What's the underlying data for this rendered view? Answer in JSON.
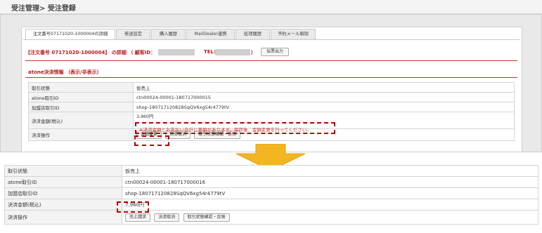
{
  "header": {
    "title": "受注管理> 受注登録"
  },
  "tabs": [
    {
      "label": "注文番号07171020-1000004の詳細",
      "active": true
    },
    {
      "label": "発送設定"
    },
    {
      "label": "購入履歴"
    },
    {
      "label": "MailDealer連携"
    },
    {
      "label": "処理履歴"
    },
    {
      "label": "予約メール解除"
    }
  ],
  "order_detail": {
    "heading": "【注文番号 07171020-1000004】 の詳細 （ 顧客ID：",
    "tel_label": "TEL:",
    "close_paren": "）",
    "print_button": "伝票出力"
  },
  "atone_section": {
    "title": "atone決済情報",
    "toggle": "（表示/非表示）"
  },
  "top_table": {
    "rows": [
      {
        "label": "取引状態",
        "value": "仮売上"
      },
      {
        "label": "atone取引ID",
        "value": "ctn00024-00001-180717000015"
      },
      {
        "label": "加盟店取引ID",
        "value": "shop-180717120828SqQV6xg54r4779tV"
      },
      {
        "label": "決済金額(税込)",
        "value": "3,960円"
      }
    ],
    "warning": "※決済金額とお支払い合計に差額があります。保存後、金額変更を行ってください。",
    "operation_label": "決済操作",
    "buttons": [
      "金額変更",
      "決済取消",
      "取引状態確認・反映"
    ]
  },
  "bottom_table": {
    "rows": [
      {
        "label": "取引状態",
        "value": "仮売上"
      },
      {
        "label": "atone取引ID",
        "value": "ctn00024-00001-180717000016"
      },
      {
        "label": "加盟店取引ID",
        "value": "shop-180717120828SqQV6xg54r4779tV"
      },
      {
        "label": "決済金額(税込)",
        "value": "7,960円"
      }
    ],
    "operation_label": "決済操作",
    "buttons": [
      "売上請求",
      "決済取消",
      "取引状態確認・反映"
    ]
  },
  "colors": {
    "accent_red": "#b71c1c",
    "arrow": "#f2b622",
    "highlight_dash": "#b30000"
  },
  "icons": {
    "arrow": "down-arrow-icon"
  }
}
